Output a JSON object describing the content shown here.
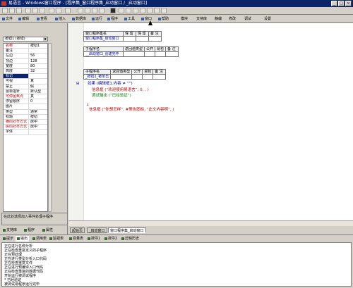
{
  "window": {
    "title": "易语言 - Windows窗口程序 - [程序集_窗口程序集_启动窗口 / _启动窗口]"
  },
  "window_buttons": [
    "_",
    "□",
    "×"
  ],
  "menu": [
    "文件",
    "编辑",
    "查看",
    "插入",
    "数据库",
    "运行",
    "程序",
    "工具",
    "窗口",
    "帮助",
    "模块",
    "支持库",
    "静编",
    "修改",
    "调试",
    "设置"
  ],
  "property_panel": {
    "object_select": "按钮1 (按钮)",
    "rows": [
      {
        "key": "名称",
        "value": "按钮1",
        "style": "red"
      },
      {
        "key": "备注",
        "value": "",
        "style": ""
      },
      {
        "key": "左边",
        "value": "56",
        "style": ""
      },
      {
        "key": "顶边",
        "value": "128",
        "style": ""
      },
      {
        "key": "宽度",
        "value": "80",
        "style": ""
      },
      {
        "key": "高度",
        "value": "32",
        "style": ""
      },
      {
        "key": "标记",
        "value": "",
        "style": "sel"
      },
      {
        "key": "可视",
        "value": "真",
        "style": ""
      },
      {
        "key": "禁止",
        "value": "假",
        "style": ""
      },
      {
        "key": "鼠标指针",
        "value": "默认型",
        "style": ""
      },
      {
        "key": "可停留焦点",
        "value": "真",
        "style": "red"
      },
      {
        "key": "停留顺序",
        "value": "0",
        "style": ""
      },
      {
        "key": "图片",
        "value": "",
        "style": ""
      },
      {
        "key": "类型",
        "value": "通常",
        "style": ""
      },
      {
        "key": "标题",
        "value": "按钮",
        "style": ""
      },
      {
        "key": "横向对齐方式",
        "value": "居中",
        "style": "red"
      },
      {
        "key": "纵向对齐方式",
        "value": "居中",
        "style": "red"
      },
      {
        "key": "字体",
        "value": "",
        "style": ""
      }
    ],
    "tip": "在此处选择加入事件处理子程序",
    "tabs": [
      "支持库",
      "程序",
      "属性"
    ]
  },
  "editor": {
    "assembly_table": {
      "headers": [
        "窗口程序集名",
        "保 留",
        "保 留",
        "备 注"
      ],
      "row": [
        "窗口程序集_启动窗口",
        "",
        "",
        ""
      ]
    },
    "sub1_table": {
      "headers": [
        "子程序名",
        "返回值类型",
        "公开",
        "易包",
        "备 注"
      ],
      "row": [
        "__启动窗口_创建完毕",
        "",
        "",
        "",
        ""
      ]
    },
    "sub2_table": {
      "headers": [
        "子程序名",
        "返回值类型",
        "公开",
        "易包",
        "备 注"
      ],
      "row": [
        "_按钮1_被单击",
        "",
        "",
        "",
        ""
      ]
    },
    "code_lines": [
      {
        "text": "如果 (编辑框1.内容 ≠ “”)",
        "style": "blue"
      },
      {
        "text": "信息框 (“欢迎使用易语言”, 0, , )",
        "style": "red"
      },
      {
        "text": "调试输出 (“已经验证”)",
        "style": "green"
      },
      {
        "text": "信息框 (“你想怎样”, #警告图标, “此文内容啊”, )",
        "style": "red"
      }
    ],
    "tabs": [
      "起始页",
      "_启动窗口",
      "窗口程序集_启动窗口"
    ]
  },
  "bottom_panel": {
    "tabs": [
      "提示",
      "输出",
      "调用表",
      "监视表",
      "变量表",
      "搜寻1",
      "搜寻2",
      "剪辑历史"
    ],
    "output_lines": [
      "正在进行名称分析",
      "正在检查重复定义的子程序",
      "正在预处理",
      "正在进行类型分析入口代码",
      "正在检查重复文件",
      "正在进行预编译入口代码",
      "正在检查重复的数据代码",
      "开始运行被调试程序",
      "* 已经验证",
      "被调试易程序运行完毕"
    ]
  }
}
